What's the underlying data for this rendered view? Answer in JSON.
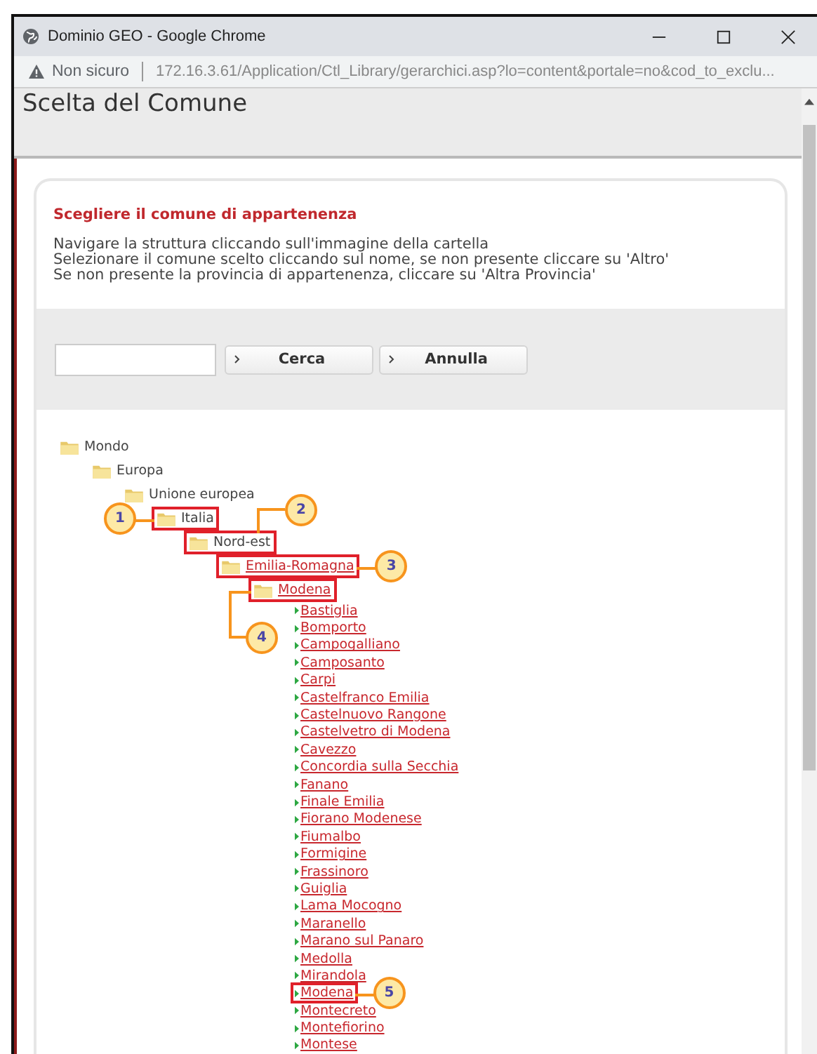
{
  "window": {
    "title": "Dominio GEO - Google Chrome"
  },
  "address_bar": {
    "security": "Non sicuro",
    "url": "172.16.3.61/Application/Ctl_Library/gerarchici.asp?lo=content&portale=no&cod_to_exclu..."
  },
  "page": {
    "title": "Scelta del Comune"
  },
  "instructions": {
    "heading": "Scegliere il comune di appartenenza",
    "lines": [
      "Navigare la struttura cliccando sull'immagine della cartella",
      "Selezionare il comune scelto cliccando sul nome, se non presente cliccare su 'Altro'",
      "Se non presente la provincia di appartenenza, cliccare su 'Altra Provincia'"
    ]
  },
  "search": {
    "buttons": [
      "Cerca",
      "Annulla"
    ]
  },
  "tree": [
    {
      "kind": "folder",
      "label": "Mondo",
      "link": false,
      "highlighted": false,
      "children": [
        {
          "kind": "folder",
          "label": "Europa",
          "link": false,
          "highlighted": false,
          "children": [
            {
              "kind": "folder",
              "label": "Unione europea",
              "link": false,
              "highlighted": false,
              "children": [
                {
                  "kind": "folder",
                  "label": "Italia",
                  "link": false,
                  "highlighted": true,
                  "callout": {
                    "label": "1",
                    "kind": "left"
                  },
                  "children": [
                    {
                      "kind": "folder",
                      "label": "Nord-est",
                      "link": false,
                      "highlighted": true,
                      "callout": {
                        "label": "2",
                        "kind": "above"
                      },
                      "children": [
                        {
                          "kind": "folder",
                          "label": "Emilia-Romagna",
                          "link": true,
                          "highlighted": true,
                          "callout": {
                            "label": "3",
                            "kind": "right"
                          },
                          "children": [
                            {
                              "kind": "folder",
                              "label": "Modena",
                              "link": true,
                              "highlighted": true,
                              "callout": {
                                "label": "4",
                                "kind": "below"
                              },
                              "children": [
                                {
                                  "kind": "comune",
                                  "label": "Bastiglia",
                                  "highlighted": false
                                },
                                {
                                  "kind": "comune",
                                  "label": "Bomporto",
                                  "highlighted": false
                                },
                                {
                                  "kind": "comune",
                                  "label": "Campogalliano",
                                  "highlighted": false
                                },
                                {
                                  "kind": "comune",
                                  "label": "Camposanto",
                                  "highlighted": false
                                },
                                {
                                  "kind": "comune",
                                  "label": "Carpi",
                                  "highlighted": false
                                },
                                {
                                  "kind": "comune",
                                  "label": "Castelfranco Emilia",
                                  "highlighted": false
                                },
                                {
                                  "kind": "comune",
                                  "label": "Castelnuovo Rangone",
                                  "highlighted": false
                                },
                                {
                                  "kind": "comune",
                                  "label": "Castelvetro di Modena",
                                  "highlighted": false
                                },
                                {
                                  "kind": "comune",
                                  "label": "Cavezzo",
                                  "highlighted": false
                                },
                                {
                                  "kind": "comune",
                                  "label": "Concordia sulla Secchia",
                                  "highlighted": false
                                },
                                {
                                  "kind": "comune",
                                  "label": "Fanano",
                                  "highlighted": false
                                },
                                {
                                  "kind": "comune",
                                  "label": "Finale Emilia",
                                  "highlighted": false
                                },
                                {
                                  "kind": "comune",
                                  "label": "Fiorano Modenese",
                                  "highlighted": false
                                },
                                {
                                  "kind": "comune",
                                  "label": "Fiumalbo",
                                  "highlighted": false
                                },
                                {
                                  "kind": "comune",
                                  "label": "Formigine",
                                  "highlighted": false
                                },
                                {
                                  "kind": "comune",
                                  "label": "Frassinoro",
                                  "highlighted": false
                                },
                                {
                                  "kind": "comune",
                                  "label": "Guiglia",
                                  "highlighted": false
                                },
                                {
                                  "kind": "comune",
                                  "label": "Lama Mocogno",
                                  "highlighted": false
                                },
                                {
                                  "kind": "comune",
                                  "label": "Maranello",
                                  "highlighted": false
                                },
                                {
                                  "kind": "comune",
                                  "label": "Marano sul Panaro",
                                  "highlighted": false
                                },
                                {
                                  "kind": "comune",
                                  "label": "Medolla",
                                  "highlighted": false
                                },
                                {
                                  "kind": "comune",
                                  "label": "Mirandola",
                                  "highlighted": false
                                },
                                {
                                  "kind": "comune",
                                  "label": "Modena",
                                  "highlighted": true,
                                  "callout": {
                                    "label": "5",
                                    "kind": "right"
                                  }
                                },
                                {
                                  "kind": "comune",
                                  "label": "Montecreto",
                                  "highlighted": false
                                },
                                {
                                  "kind": "comune",
                                  "label": "Montefiorino",
                                  "highlighted": false
                                },
                                {
                                  "kind": "comune",
                                  "label": "Montese",
                                  "highlighted": false
                                }
                              ]
                            }
                          ]
                        }
                      ]
                    }
                  ]
                }
              ]
            }
          ]
        }
      ]
    }
  ]
}
